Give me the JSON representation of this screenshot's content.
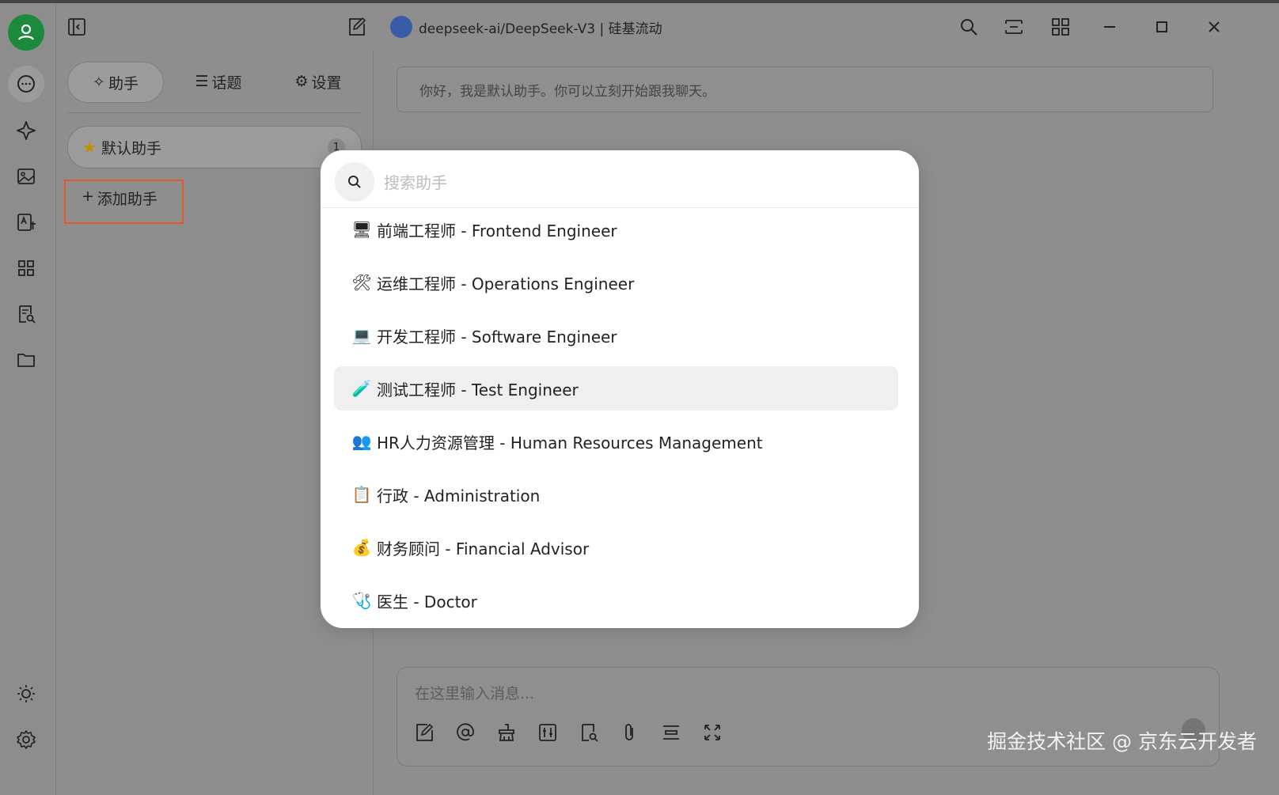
{
  "window": {
    "title": "deepseek-ai/DeepSeek-V3 | 硅基流动"
  },
  "sidebar": {
    "tabs": [
      {
        "label": "助手",
        "icon": "sparkle-icon",
        "active": true
      },
      {
        "label": "话题",
        "icon": "list-icon",
        "active": false
      },
      {
        "label": "设置",
        "icon": "gear-icon",
        "active": false
      }
    ],
    "assistant": {
      "name": "默认助手",
      "count": "1"
    },
    "add_label": "添加助手"
  },
  "chat": {
    "greeting": "你好，我是默认助手。你可以立刻开始跟我聊天。",
    "input_placeholder": "在这里输入消息..."
  },
  "modal": {
    "search_placeholder": "搜索助手",
    "items": [
      {
        "emoji": "🖥",
        "label": "前端工程师 - Frontend Engineer"
      },
      {
        "emoji": "🛠",
        "label": "运维工程师 - Operations Engineer"
      },
      {
        "emoji": "💻",
        "label": "开发工程师 - Software Engineer"
      },
      {
        "emoji": "🧪",
        "label": "测试工程师 - Test Engineer",
        "highlighted": true
      },
      {
        "emoji": "👥",
        "label": "HR人力资源管理 - Human Resources Management"
      },
      {
        "emoji": "📋",
        "label": "行政 - Administration"
      },
      {
        "emoji": "💰",
        "label": "财务顾问 - Financial Advisor"
      },
      {
        "emoji": "🩺",
        "label": "医生 - Doctor"
      }
    ]
  },
  "watermark": "掘金技术社区 @ 京东云开发者",
  "colors": {
    "accent_green": "#1b8a3c",
    "highlight_border": "#e6562a"
  }
}
